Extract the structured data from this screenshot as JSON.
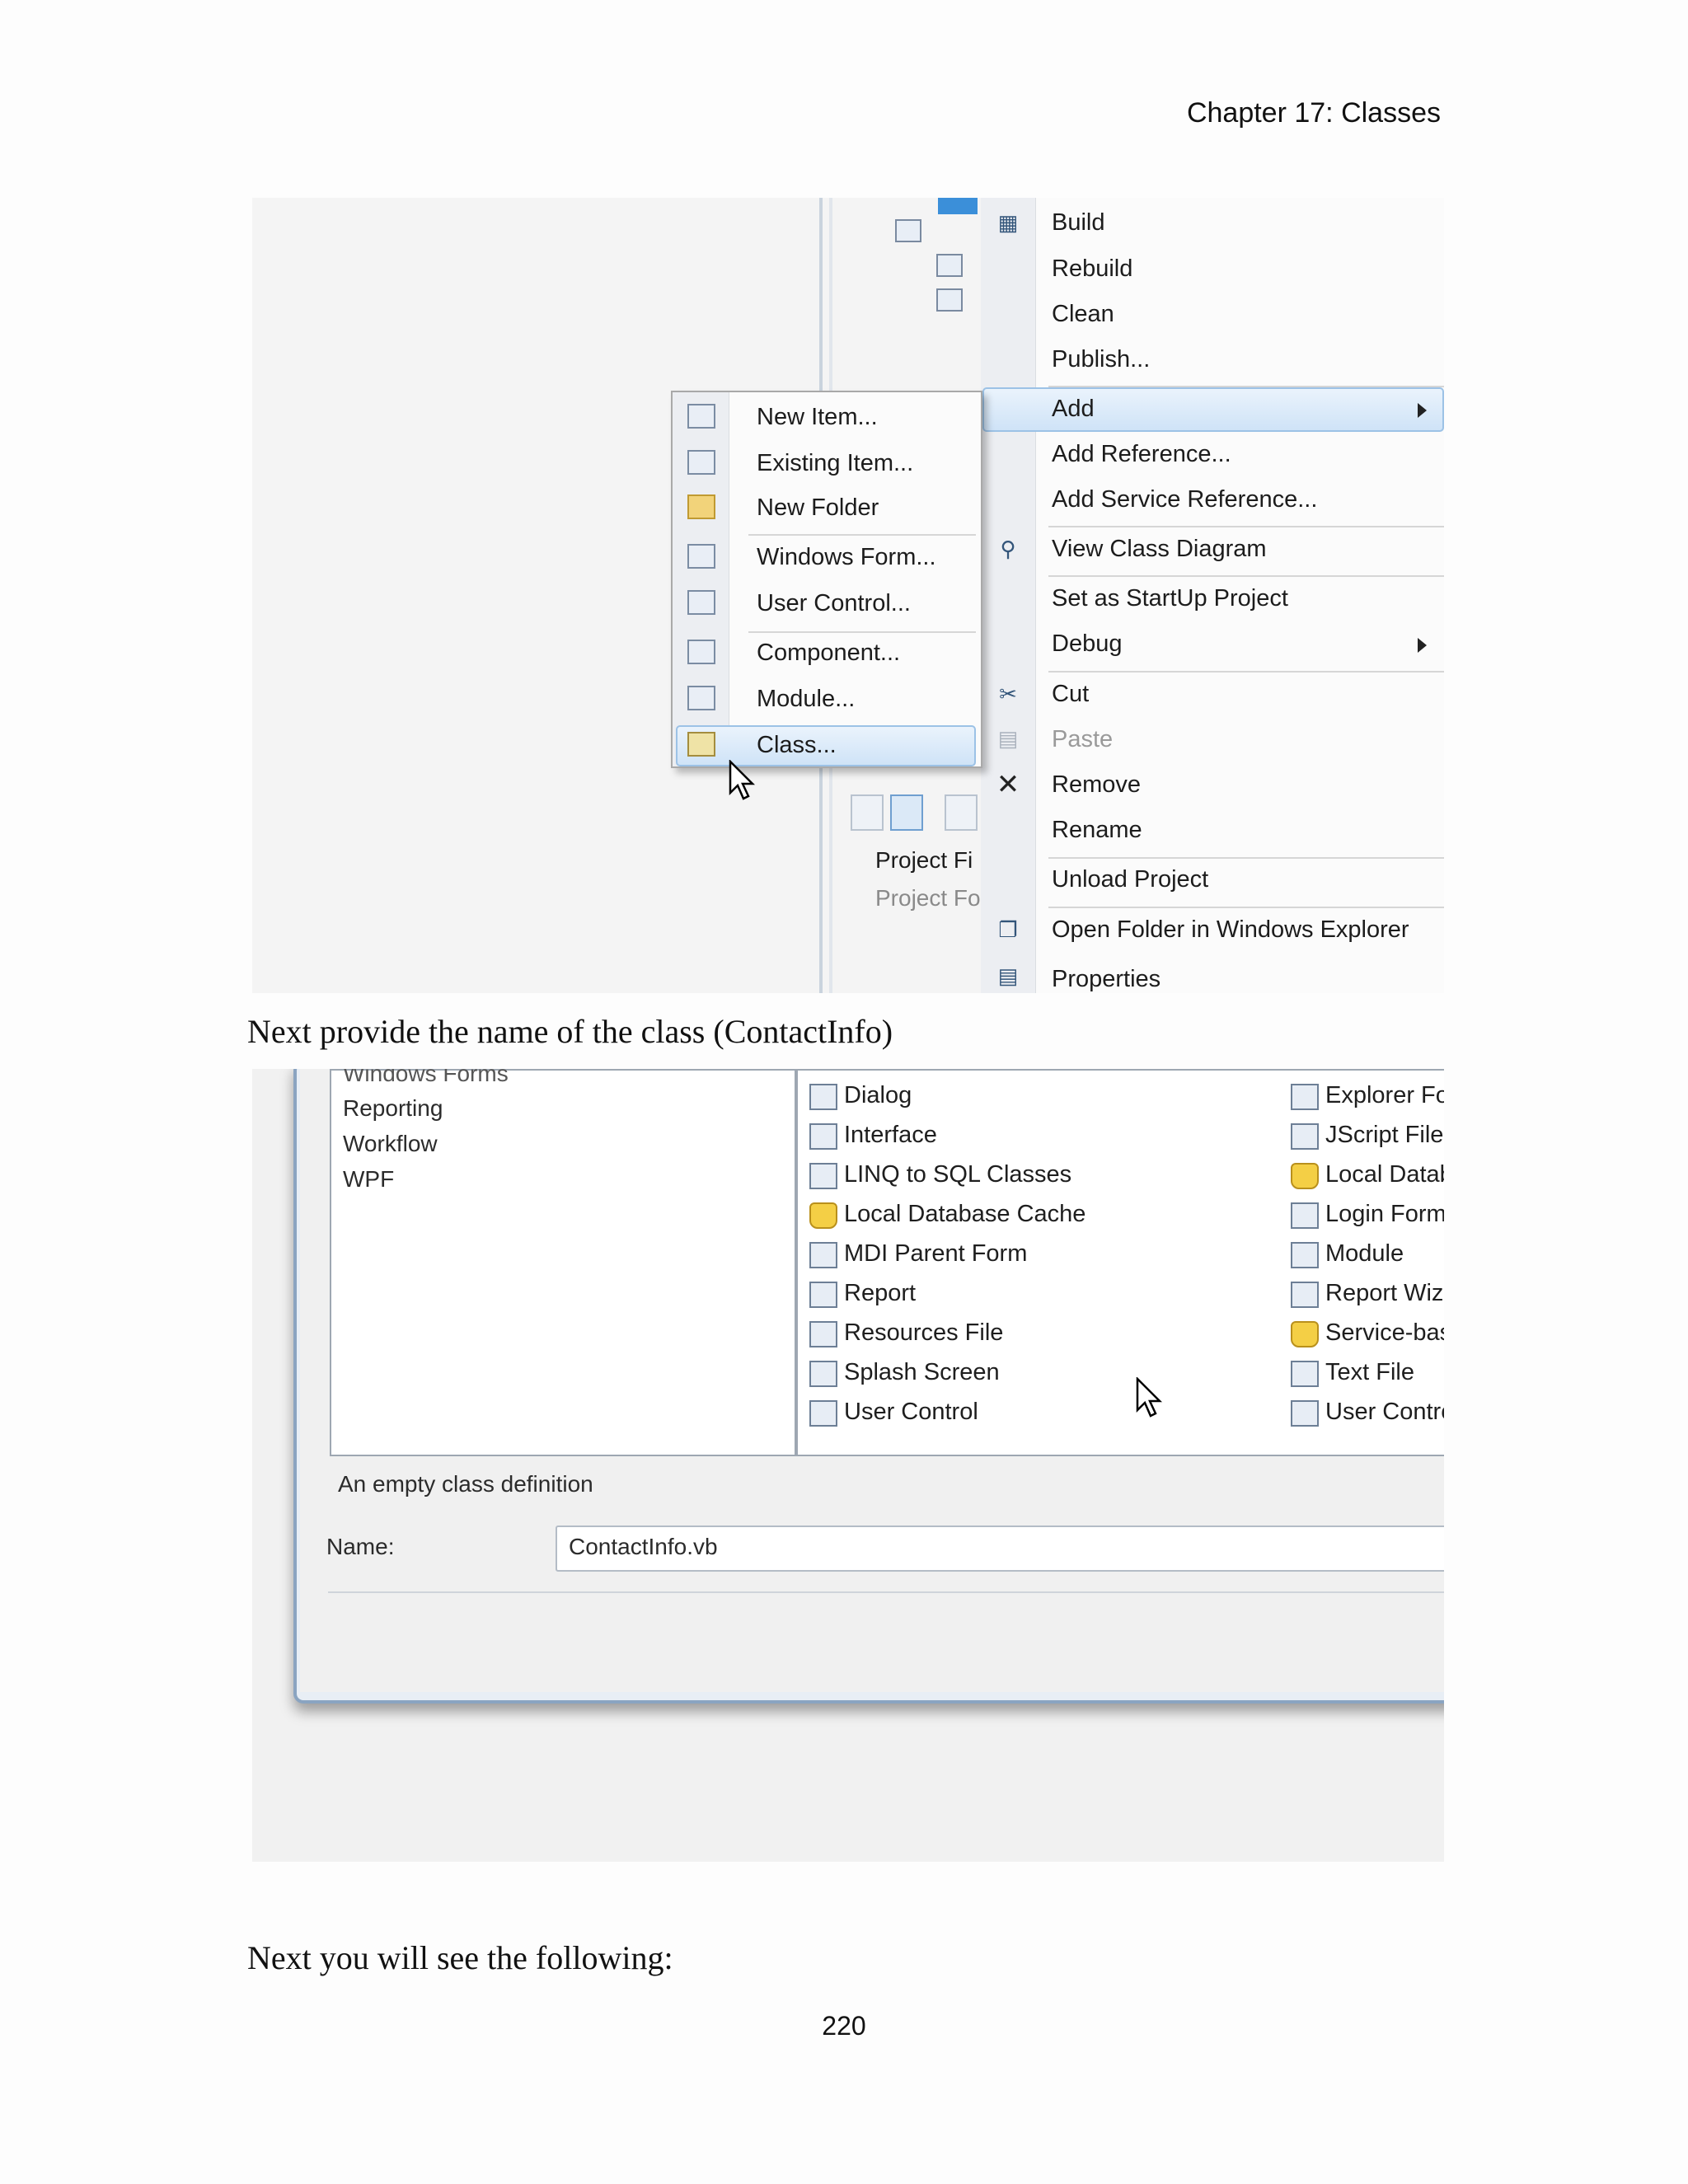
{
  "page": {
    "header": "Chapter 17: Classes",
    "caption_1": "Next provide the name of the class (ContactInfo)",
    "caption_2": "Next you will see the following:",
    "page_number": "220"
  },
  "context_menu": {
    "items": [
      "Build",
      "Rebuild",
      "Clean",
      "Publish...",
      "Add",
      "Add Reference...",
      "Add Service Reference...",
      "View Class Diagram",
      "Set as StartUp Project",
      "Debug",
      "Cut",
      "Paste",
      "Remove",
      "Rename",
      "Unload Project",
      "Open Folder in Windows Explorer",
      "Properties"
    ],
    "highlighted": "Add",
    "disabled": [
      "Paste"
    ]
  },
  "add_submenu": {
    "items": [
      "New Item...",
      "Existing Item...",
      "New Folder",
      "Windows Form...",
      "User Control...",
      "Component...",
      "Module...",
      "Class..."
    ],
    "highlighted": "Class..."
  },
  "properties_panel": {
    "rows": [
      "Project Fi",
      "Project Fo"
    ]
  },
  "add_new_item_dialog": {
    "categories": [
      "Windows Forms",
      "Reporting",
      "Workflow",
      "WPF"
    ],
    "templates_col1": [
      "Dialog",
      "Interface",
      "LINQ to SQL Classes",
      "Local Database Cache",
      "MDI Parent Form",
      "Report",
      "Resources File",
      "Splash Screen",
      "User Control"
    ],
    "templates_col2": [
      "Explorer For",
      "JScript File",
      "Local Datab",
      "Login Form",
      "Module",
      "Report Wiza",
      "Service-bas",
      "Text File",
      "User Contro"
    ],
    "description": "An empty class definition",
    "name_label": "Name:",
    "name_value": "ContactInfo.vb"
  },
  "colors": {
    "highlight_fill": "#cfe3f7",
    "highlight_border": "#9cc2e6",
    "frame_border": "#8aa4c1"
  }
}
